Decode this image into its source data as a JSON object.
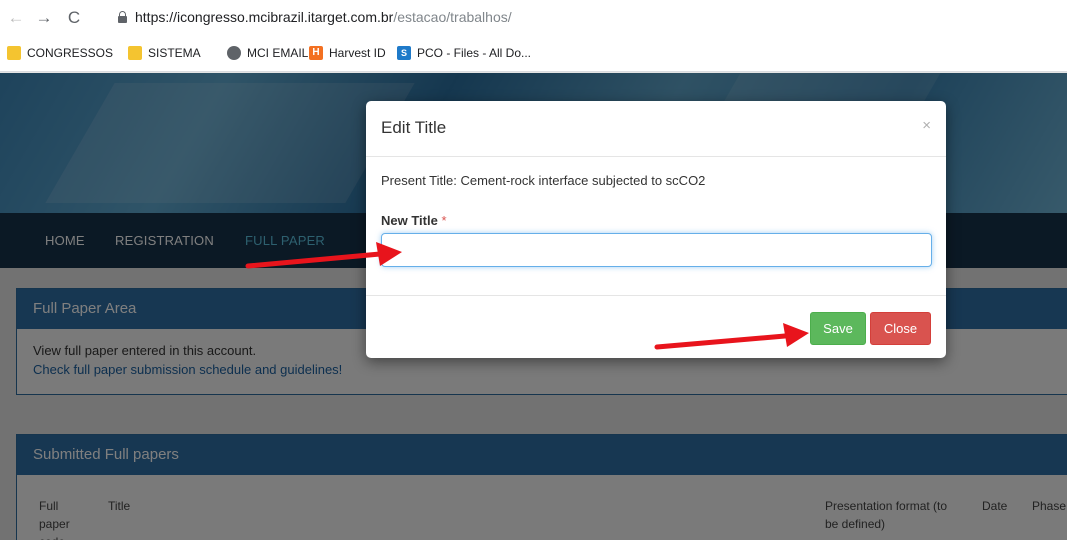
{
  "browser": {
    "url_main": "https://icongresso.mcibrazil.itarget.com.br",
    "url_path": "/estacao/trabalhos/",
    "bookmarks": [
      {
        "label": "CONGRESSOS",
        "icon": "folder-icon"
      },
      {
        "label": "SISTEMA",
        "icon": "folder-icon"
      },
      {
        "label": "MCI EMAIL",
        "icon": "globe-icon"
      },
      {
        "label": "Harvest ID",
        "icon": "harvest-icon",
        "badge": "H"
      },
      {
        "label": "PCO - Files - All Do...",
        "icon": "sharepoint-icon",
        "badge": "S"
      }
    ]
  },
  "nav": {
    "items": [
      "HOME",
      "REGISTRATION",
      "FULL PAPER"
    ],
    "active": "FULL PAPER"
  },
  "full_paper_panel": {
    "title": "Full Paper Area",
    "line1": "View full paper entered in this account.",
    "line2": "Check full paper submission schedule and guidelines!"
  },
  "submitted_panel": {
    "title": "Submitted Full papers",
    "columns": {
      "code": "Full\npaper\ncode",
      "title": "Title",
      "format": "Presentation format (to\nbe defined)",
      "date": "Date",
      "phase": "Phase"
    }
  },
  "modal": {
    "title": "Edit Title",
    "close_glyph": "×",
    "present_title": "Present Title: Cement-rock interface subjected to scCO2",
    "new_title_label": "New Title",
    "required_mark": "*",
    "input_value": "",
    "save_label": "Save",
    "close_label": "Close"
  },
  "colors": {
    "navbar": "#17324a",
    "panel_header": "#2f6fa5",
    "save": "#5cb85c",
    "close": "#d9534f",
    "arrow": "#e8141c"
  }
}
